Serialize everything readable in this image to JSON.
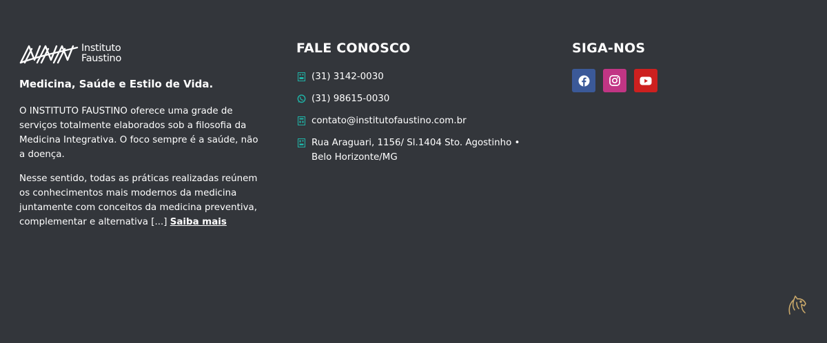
{
  "about": {
    "logo_line1": "Instituto",
    "logo_line2": "Faustino",
    "tagline": "Medicina, Saúde e Estilo de Vida.",
    "paragraph1": "O INSTITUTO FAUSTINO oferece uma grade de serviços totalmente elaborados sob a filosofia da Medicina Integrativa. O foco sempre é a saúde, não a doença.",
    "paragraph2": "Nesse sentido, todas as práticas realizadas reúnem os conhecimentos mais modernos da medicina juntamente com conceitos da medicina preventiva, complementar e alternativa [...] ",
    "read_more": "Saiba mais"
  },
  "contact": {
    "heading": "FALE CONOSCO",
    "items": [
      {
        "icon": "phone-icon",
        "text": "(31) 3142-0030"
      },
      {
        "icon": "whatsapp-icon",
        "text": "(31) 98615-0030"
      },
      {
        "icon": "email-icon",
        "text": "contato@institutofaustino.com.br"
      },
      {
        "icon": "location-icon",
        "text": "Rua Araguari, 1156/ Sl.1404 Sto. Agostinho •\nBelo Horizonte/MG"
      }
    ]
  },
  "social": {
    "heading": "SIGA-NOS",
    "buttons": [
      {
        "icon": "facebook-icon",
        "color": "#3b5998"
      },
      {
        "icon": "instagram-icon",
        "color": "#c13584"
      },
      {
        "icon": "youtube-icon",
        "color": "#cd201f"
      }
    ]
  },
  "colors": {
    "background": "#33363b",
    "accent_teal": "#1fb5a8",
    "badge_gold": "#c9a86a"
  }
}
